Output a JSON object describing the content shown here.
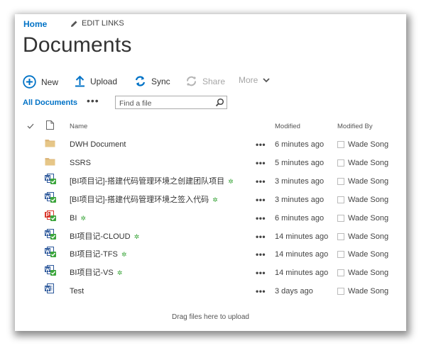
{
  "nav": {
    "home": "Home",
    "edit_links": "EDIT LINKS"
  },
  "page_title": "Documents",
  "commands": {
    "new": "New",
    "upload": "Upload",
    "sync": "Sync",
    "share": "Share",
    "more": "More"
  },
  "view": {
    "all_documents": "All Documents",
    "view_options": "•••",
    "search_placeholder": "Find a file"
  },
  "columns": {
    "name": "Name",
    "modified": "Modified",
    "modified_by": "Modified By"
  },
  "files": [
    {
      "type": "folder",
      "name": "DWH Document",
      "new": "",
      "modified": "6 minutes ago",
      "modified_by": "Wade Song"
    },
    {
      "type": "folder",
      "name": "SSRS",
      "new": "",
      "modified": "5 minutes ago",
      "modified_by": "Wade Song"
    },
    {
      "type": "word",
      "name": "[BI项目记]-搭建代码管理环境之创建团队项目",
      "new": "✲",
      "modified": "3 minutes ago",
      "modified_by": "Wade Song"
    },
    {
      "type": "word",
      "name": "[BI项目记]-搭建代码管理环境之签入代码",
      "new": "✲",
      "modified": "3 minutes ago",
      "modified_by": "Wade Song"
    },
    {
      "type": "pdf",
      "name": "BI",
      "new": "✲",
      "modified": "6 minutes ago",
      "modified_by": "Wade Song"
    },
    {
      "type": "word",
      "name": "BI项目记-CLOUD",
      "new": "✲",
      "modified": "14 minutes ago",
      "modified_by": "Wade Song"
    },
    {
      "type": "word",
      "name": "BI项目记-TFS",
      "new": "✲",
      "modified": "14 minutes ago",
      "modified_by": "Wade Song"
    },
    {
      "type": "word",
      "name": "BI项目记-VS",
      "new": "✲",
      "modified": "14 minutes ago",
      "modified_by": "Wade Song"
    },
    {
      "type": "word-plain",
      "name": "Test",
      "new": "",
      "modified": "3 days ago",
      "modified_by": "Wade Song"
    }
  ],
  "row_menu": "•••",
  "drag_hint": "Drag files here to upload",
  "colors": {
    "link_blue": "#0072c6",
    "folder": "#dcb67a",
    "word_blue": "#2b579a",
    "pdf_red": "#d9372b",
    "new_green": "#3aa53a"
  }
}
